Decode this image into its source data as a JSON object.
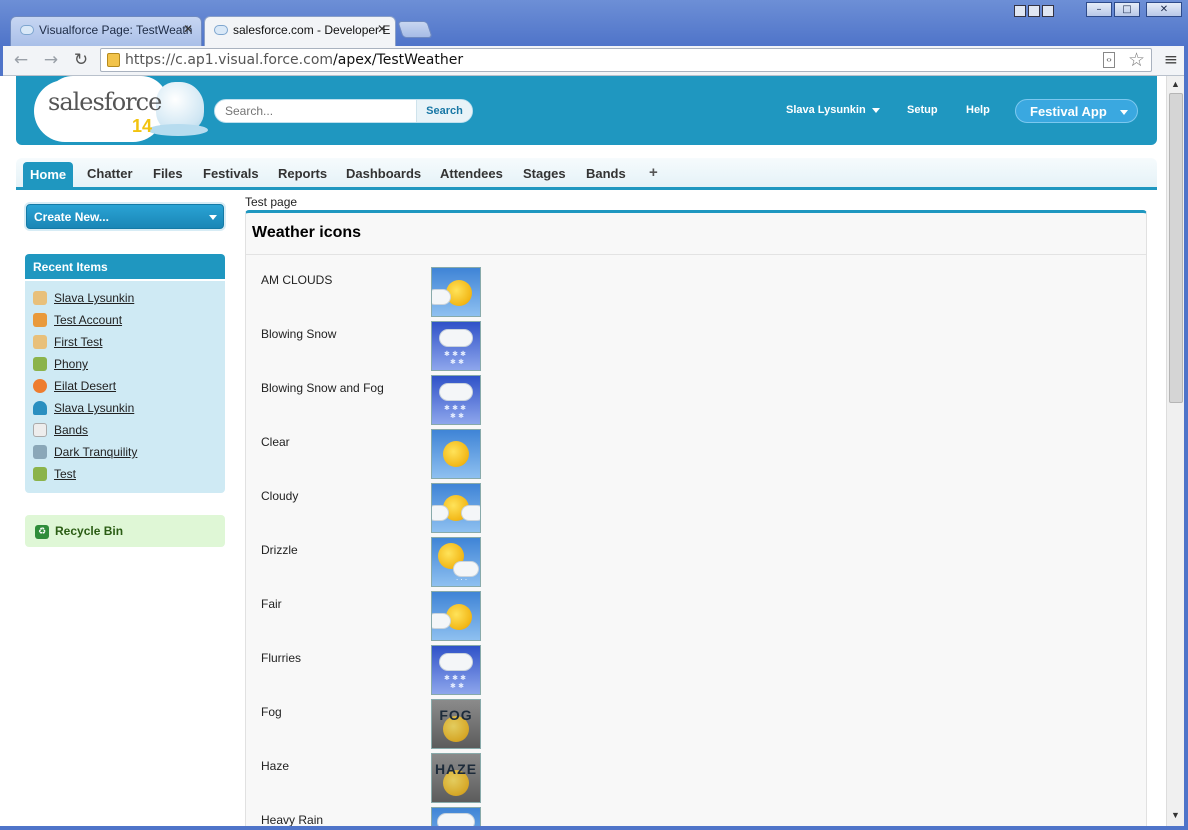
{
  "browser": {
    "tabs": [
      {
        "title": "Visualforce Page: TestWeath",
        "active": false
      },
      {
        "title": "salesforce.com - Developer E",
        "active": true
      }
    ],
    "url_host": "https://c.ap1.visual.force.com",
    "url_path": "/apex/TestWeather"
  },
  "header": {
    "logo_text": "salesforce",
    "logo_version": "14",
    "search_placeholder": "Search...",
    "search_button": "Search",
    "user_name": "Slava Lysunkin",
    "setup": "Setup",
    "help": "Help",
    "app_name": "Festival App"
  },
  "nav_tabs": [
    "Home",
    "Chatter",
    "Files",
    "Festivals",
    "Reports",
    "Dashboards",
    "Attendees",
    "Stages",
    "Bands",
    "+"
  ],
  "sidebar": {
    "create_new": "Create New...",
    "recent_title": "Recent Items",
    "recent_items": [
      {
        "label": "Slava Lysunkin",
        "icon": "contact-card-icon",
        "color": "#e8c07a"
      },
      {
        "label": "Test Account",
        "icon": "account-icon",
        "color": "#e99a3b"
      },
      {
        "label": "First Test",
        "icon": "contact-card-icon",
        "color": "#e8c07a"
      },
      {
        "label": "Phony",
        "icon": "people-icon",
        "color": "#8bb34a"
      },
      {
        "label": "Eilat Desert",
        "icon": "heart-icon",
        "color": "#ee7d2f"
      },
      {
        "label": "Slava Lysunkin",
        "icon": "user-icon",
        "color": "#2a8fc0"
      },
      {
        "label": "Bands",
        "icon": "document-icon",
        "color": "#d9d9d9"
      },
      {
        "label": "Dark Tranquility",
        "icon": "music-icon",
        "color": "#8aa7b8"
      },
      {
        "label": "Test",
        "icon": "people-icon",
        "color": "#8bb34a"
      }
    ],
    "recycle_bin": "Recycle Bin"
  },
  "main": {
    "breadcrumb": "Test page",
    "panel_title": "Weather icons",
    "weather": [
      {
        "name": "AM CLOUDS",
        "icon": "am-clouds-icon"
      },
      {
        "name": "Blowing Snow",
        "icon": "blowing-snow-icon"
      },
      {
        "name": "Blowing Snow and Fog",
        "icon": "blowing-snow-fog-icon"
      },
      {
        "name": "Clear",
        "icon": "clear-icon"
      },
      {
        "name": "Cloudy",
        "icon": "cloudy-icon"
      },
      {
        "name": "Drizzle",
        "icon": "drizzle-icon"
      },
      {
        "name": "Fair",
        "icon": "fair-icon"
      },
      {
        "name": "Flurries",
        "icon": "flurries-icon"
      },
      {
        "name": "Fog",
        "icon": "fog-icon",
        "label": "FOG"
      },
      {
        "name": "Haze",
        "icon": "haze-icon",
        "label": "HAZE"
      },
      {
        "name": "Heavy Rain",
        "icon": "heavy-rain-icon"
      }
    ]
  },
  "colors": {
    "brand": "#1f97c0",
    "sidebar_bg": "#cfeaf4",
    "recycle_bg": "#dff7d6"
  }
}
